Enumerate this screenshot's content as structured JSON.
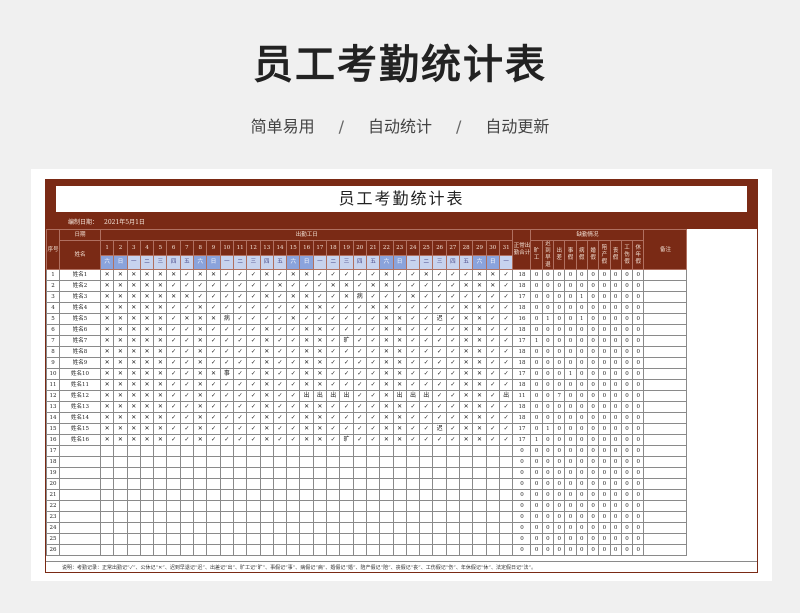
{
  "hero": {
    "title": "员工考勤统计表",
    "tags": [
      "简单易用",
      "自动统计",
      "自动更新"
    ],
    "separator": "/"
  },
  "sheet": {
    "title": "员工考勤统计表",
    "date_label": "编制日期：",
    "date_value": "2021年5月1日",
    "headers": {
      "seq": "序号",
      "date": "日期",
      "name": "姓名",
      "attendance": "出勤工日",
      "normal_days": "正常出勤合计",
      "leave_title": "缺勤情况",
      "remark": "备注",
      "leave_cols": [
        "旷工",
        "迟到早退",
        "出差",
        "事假",
        "病假",
        "婚假",
        "陪产假",
        "丧假",
        "工伤假",
        "休年假"
      ]
    },
    "day_numbers": [
      "1",
      "2",
      "3",
      "4",
      "5",
      "6",
      "7",
      "8",
      "9",
      "10",
      "11",
      "12",
      "13",
      "14",
      "15",
      "16",
      "17",
      "18",
      "19",
      "20",
      "21",
      "22",
      "23",
      "24",
      "25",
      "26",
      "27",
      "28",
      "29",
      "30",
      "31"
    ],
    "weekdays": [
      "六",
      "日",
      "一",
      "二",
      "三",
      "四",
      "五",
      "六",
      "日",
      "一",
      "二",
      "三",
      "四",
      "五",
      "六",
      "日",
      "一",
      "二",
      "三",
      "四",
      "五",
      "六",
      "日",
      "一",
      "二",
      "三",
      "四",
      "五",
      "六",
      "日",
      "一"
    ],
    "weekend_flags": [
      1,
      1,
      0,
      0,
      0,
      0,
      0,
      1,
      1,
      0,
      0,
      0,
      0,
      0,
      1,
      1,
      0,
      0,
      0,
      0,
      0,
      1,
      1,
      0,
      0,
      0,
      0,
      0,
      1,
      1,
      0
    ],
    "rows": [
      {
        "seq": "1",
        "name": "姓名1",
        "days": [
          "✕",
          "✕",
          "✕",
          "✕",
          "✕",
          "✕",
          "✓",
          "✕",
          "✕",
          "✓",
          "✓",
          "✓",
          "✕",
          "✓",
          "✕",
          "✕",
          "✓",
          "✓",
          "✓",
          "✓",
          "✓",
          "✕",
          "✓",
          "✓",
          "✕",
          "✓",
          "✓",
          "✓",
          "✕",
          "✕",
          "✓"
        ],
        "total": "18",
        "stats": [
          "0",
          "0",
          "0",
          "0",
          "0",
          "0",
          "0",
          "0",
          "0",
          "0"
        ]
      },
      {
        "seq": "2",
        "name": "姓名2",
        "days": [
          "✕",
          "✕",
          "✕",
          "✕",
          "✕",
          "✓",
          "✓",
          "✓",
          "✓",
          "✓",
          "✓",
          "✓",
          "✓",
          "✕",
          "✓",
          "✓",
          "✓",
          "✕",
          "✕",
          "✓",
          "✕",
          "✕",
          "✓",
          "✓",
          "✓",
          "✓",
          "✓",
          "✕",
          "✕",
          "✕",
          "✓"
        ],
        "total": "18",
        "stats": [
          "0",
          "0",
          "0",
          "0",
          "0",
          "0",
          "0",
          "0",
          "0",
          "0"
        ]
      },
      {
        "seq": "3",
        "name": "姓名3",
        "days": [
          "✕",
          "✕",
          "✕",
          "✕",
          "✕",
          "✕",
          "✕",
          "✓",
          "✓",
          "✓",
          "✓",
          "✓",
          "✕",
          "✓",
          "✕",
          "✕",
          "✓",
          "✓",
          "✕",
          "病",
          "✓",
          "✓",
          "✓",
          "✕",
          "✓",
          "✓",
          "✓",
          "✓",
          "✓",
          "✓",
          "✓"
        ],
        "total": "17",
        "stats": [
          "0",
          "0",
          "0",
          "0",
          "1",
          "0",
          "0",
          "0",
          "0",
          "0"
        ]
      },
      {
        "seq": "4",
        "name": "姓名4",
        "days": [
          "✕",
          "✕",
          "✕",
          "✕",
          "✕",
          "✓",
          "✓",
          "✕",
          "✓",
          "✓",
          "✓",
          "✓",
          "✓",
          "✓",
          "✓",
          "✕",
          "✕",
          "✓",
          "✓",
          "✓",
          "✕",
          "✕",
          "✓",
          "✓",
          "✓",
          "✓",
          "✓",
          "✕",
          "✕",
          "✓",
          "✓"
        ],
        "total": "18",
        "stats": [
          "0",
          "0",
          "0",
          "0",
          "0",
          "0",
          "0",
          "0",
          "0",
          "0"
        ]
      },
      {
        "seq": "5",
        "name": "姓名5",
        "days": [
          "✕",
          "✕",
          "✕",
          "✕",
          "✕",
          "✓",
          "✕",
          "✕",
          "✕",
          "病",
          "✓",
          "✓",
          "✓",
          "✓",
          "✕",
          "✓",
          "✓",
          "✓",
          "✓",
          "✓",
          "✓",
          "✕",
          "✕",
          "✓",
          "✓",
          "迟",
          "✓",
          "✕",
          "✕",
          "✓",
          "✓"
        ],
        "total": "16",
        "stats": [
          "0",
          "1",
          "0",
          "0",
          "1",
          "0",
          "0",
          "0",
          "0",
          "0"
        ]
      },
      {
        "seq": "6",
        "name": "姓名6",
        "days": [
          "✕",
          "✕",
          "✕",
          "✕",
          "✕",
          "✓",
          "✓",
          "✕",
          "✓",
          "✓",
          "✓",
          "✓",
          "✕",
          "✓",
          "✓",
          "✕",
          "✕",
          "✓",
          "✓",
          "✓",
          "✓",
          "✕",
          "✕",
          "✓",
          "✓",
          "✓",
          "✓",
          "✕",
          "✕",
          "✓",
          "✓"
        ],
        "total": "18",
        "stats": [
          "0",
          "0",
          "0",
          "0",
          "0",
          "0",
          "0",
          "0",
          "0",
          "0"
        ]
      },
      {
        "seq": "7",
        "name": "姓名7",
        "days": [
          "✕",
          "✕",
          "✕",
          "✕",
          "✕",
          "✓",
          "✓",
          "✕",
          "✓",
          "✓",
          "✓",
          "✓",
          "✕",
          "✓",
          "✓",
          "✕",
          "✕",
          "✓",
          "旷",
          "✓",
          "✓",
          "✕",
          "✕",
          "✓",
          "✓",
          "✓",
          "✓",
          "✕",
          "✕",
          "✓",
          "✓"
        ],
        "total": "17",
        "stats": [
          "1",
          "0",
          "0",
          "0",
          "0",
          "0",
          "0",
          "0",
          "0",
          "0"
        ]
      },
      {
        "seq": "8",
        "name": "姓名8",
        "days": [
          "✕",
          "✕",
          "✕",
          "✕",
          "✕",
          "✓",
          "✓",
          "✕",
          "✓",
          "✓",
          "✓",
          "✓",
          "✕",
          "✓",
          "✓",
          "✕",
          "✕",
          "✓",
          "✓",
          "✓",
          "✓",
          "✕",
          "✕",
          "✓",
          "✓",
          "✓",
          "✓",
          "✕",
          "✕",
          "✓",
          "✓"
        ],
        "total": "18",
        "stats": [
          "0",
          "0",
          "0",
          "0",
          "0",
          "0",
          "0",
          "0",
          "0",
          "0"
        ]
      },
      {
        "seq": "9",
        "name": "姓名9",
        "days": [
          "✕",
          "✕",
          "✕",
          "✕",
          "✕",
          "✓",
          "✓",
          "✕",
          "✓",
          "✓",
          "✓",
          "✓",
          "✕",
          "✓",
          "✓",
          "✕",
          "✕",
          "✓",
          "✓",
          "✓",
          "✓",
          "✕",
          "✕",
          "✓",
          "✓",
          "✓",
          "✓",
          "✕",
          "✕",
          "✓",
          "✓"
        ],
        "total": "18",
        "stats": [
          "0",
          "0",
          "0",
          "0",
          "0",
          "0",
          "0",
          "0",
          "0",
          "0"
        ]
      },
      {
        "seq": "10",
        "name": "姓名10",
        "days": [
          "✕",
          "✕",
          "✕",
          "✕",
          "✕",
          "✓",
          "✓",
          "✕",
          "✕",
          "事",
          "✓",
          "✓",
          "✕",
          "✓",
          "✓",
          "✕",
          "✕",
          "✓",
          "✓",
          "✓",
          "✓",
          "✕",
          "✕",
          "✓",
          "✓",
          "✓",
          "✓",
          "✕",
          "✕",
          "✓",
          "✓"
        ],
        "total": "17",
        "stats": [
          "0",
          "0",
          "0",
          "1",
          "0",
          "0",
          "0",
          "0",
          "0",
          "0"
        ]
      },
      {
        "seq": "11",
        "name": "姓名11",
        "days": [
          "✕",
          "✕",
          "✕",
          "✕",
          "✕",
          "✓",
          "✓",
          "✕",
          "✓",
          "✓",
          "✓",
          "✓",
          "✕",
          "✓",
          "✓",
          "✕",
          "✕",
          "✓",
          "✓",
          "✓",
          "✓",
          "✕",
          "✕",
          "✓",
          "✓",
          "✓",
          "✓",
          "✕",
          "✕",
          "✓",
          "✓"
        ],
        "total": "18",
        "stats": [
          "0",
          "0",
          "0",
          "0",
          "0",
          "0",
          "0",
          "0",
          "0",
          "0"
        ]
      },
      {
        "seq": "12",
        "name": "姓名12",
        "days": [
          "✕",
          "✕",
          "✕",
          "✕",
          "✕",
          "✓",
          "✓",
          "✕",
          "✓",
          "✓",
          "✓",
          "✓",
          "✕",
          "✓",
          "✓",
          "出",
          "出",
          "出",
          "出",
          "✓",
          "✓",
          "✕",
          "出",
          "出",
          "出",
          "✓",
          "✓",
          "✕",
          "✕",
          "✓",
          "出"
        ],
        "total": "11",
        "stats": [
          "0",
          "0",
          "7",
          "0",
          "0",
          "0",
          "0",
          "0",
          "0",
          "0"
        ]
      },
      {
        "seq": "13",
        "name": "姓名13",
        "days": [
          "✕",
          "✕",
          "✕",
          "✕",
          "✕",
          "✓",
          "✓",
          "✕",
          "✓",
          "✓",
          "✓",
          "✓",
          "✕",
          "✓",
          "✓",
          "✕",
          "✕",
          "✓",
          "✓",
          "✓",
          "✓",
          "✕",
          "✕",
          "✓",
          "✓",
          "✓",
          "✓",
          "✕",
          "✕",
          "✓",
          "✓"
        ],
        "total": "18",
        "stats": [
          "0",
          "0",
          "0",
          "0",
          "0",
          "0",
          "0",
          "0",
          "0",
          "0"
        ]
      },
      {
        "seq": "14",
        "name": "姓名14",
        "days": [
          "✕",
          "✕",
          "✕",
          "✕",
          "✕",
          "✓",
          "✓",
          "✕",
          "✓",
          "✓",
          "✓",
          "✓",
          "✕",
          "✓",
          "✓",
          "✕",
          "✕",
          "✓",
          "✓",
          "✓",
          "✓",
          "✕",
          "✕",
          "✓",
          "✓",
          "✓",
          "✓",
          "✕",
          "✕",
          "✓",
          "✓"
        ],
        "total": "18",
        "stats": [
          "0",
          "0",
          "0",
          "0",
          "0",
          "0",
          "0",
          "0",
          "0",
          "0"
        ]
      },
      {
        "seq": "15",
        "name": "姓名15",
        "days": [
          "✕",
          "✕",
          "✕",
          "✕",
          "✕",
          "✓",
          "✓",
          "✕",
          "✓",
          "✓",
          "✓",
          "✓",
          "✕",
          "✓",
          "✓",
          "✕",
          "✕",
          "✓",
          "✓",
          "✓",
          "✓",
          "✕",
          "✕",
          "✓",
          "✓",
          "迟",
          "✓",
          "✕",
          "✕",
          "✓",
          "✓"
        ],
        "total": "17",
        "stats": [
          "0",
          "1",
          "0",
          "0",
          "0",
          "0",
          "0",
          "0",
          "0",
          "0"
        ]
      },
      {
        "seq": "16",
        "name": "姓名16",
        "days": [
          "✕",
          "✕",
          "✕",
          "✕",
          "✕",
          "✓",
          "✓",
          "✕",
          "✓",
          "✓",
          "✓",
          "✓",
          "✕",
          "✓",
          "✓",
          "✕",
          "✕",
          "✓",
          "旷",
          "✓",
          "✓",
          "✕",
          "✕",
          "✓",
          "✓",
          "✓",
          "✓",
          "✕",
          "✕",
          "✓",
          "✓"
        ],
        "total": "17",
        "stats": [
          "1",
          "0",
          "0",
          "0",
          "0",
          "0",
          "0",
          "0",
          "0",
          "0"
        ]
      }
    ],
    "empty_rows": [
      "17",
      "18",
      "19",
      "20",
      "21",
      "22",
      "23",
      "24",
      "25",
      "26"
    ],
    "empty_total": "0",
    "note": "说明：考勤记录：正常出勤记“✓”、公休记“✕”、迟到早退记“迟”、出差记“出”、旷工记“旷”、事假记“事”、病假记“病”、婚假记“婚”、陪产假记“陪”、丧假记“丧”、工伤假记“伤”、年休假记“休”、法定假日记“法”。"
  }
}
